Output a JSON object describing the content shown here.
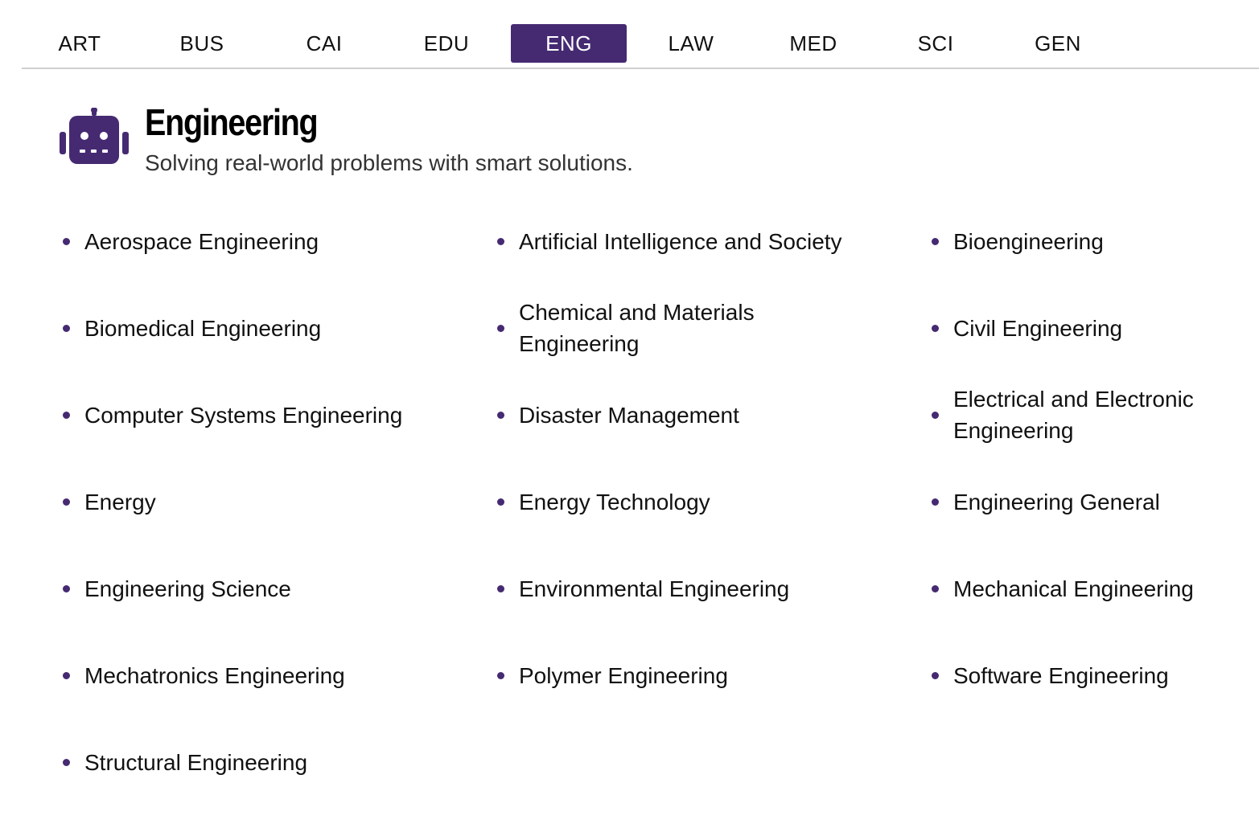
{
  "tabs": [
    {
      "label": "ART",
      "active": false
    },
    {
      "label": "BUS",
      "active": false
    },
    {
      "label": "CAI",
      "active": false
    },
    {
      "label": "EDU",
      "active": false
    },
    {
      "label": "ENG",
      "active": true
    },
    {
      "label": "LAW",
      "active": false
    },
    {
      "label": "MED",
      "active": false
    },
    {
      "label": "SCI",
      "active": false
    },
    {
      "label": "GEN",
      "active": false
    }
  ],
  "header": {
    "icon": "robot-icon",
    "title": "Engineering",
    "subtitle": "Solving real-world problems with smart solutions."
  },
  "subjects": [
    "Aerospace Engineering",
    "Artificial Intelligence and Society",
    "Bioengineering",
    "Biomedical Engineering",
    "Chemical and Materials Engineering",
    "Civil Engineering",
    "Computer Systems Engineering",
    "Disaster Management",
    "Electrical and Electronic Engineering",
    "Energy",
    "Energy Technology",
    "Engineering General",
    "Engineering Science",
    "Environmental Engineering",
    "Mechanical Engineering",
    "Mechatronics Engineering",
    "Polymer Engineering",
    "Software Engineering",
    "Structural Engineering"
  ],
  "colors": {
    "accent": "#452a72",
    "tab_border": "#d0d0d0",
    "text": "#111111",
    "subtitle": "#333333"
  }
}
